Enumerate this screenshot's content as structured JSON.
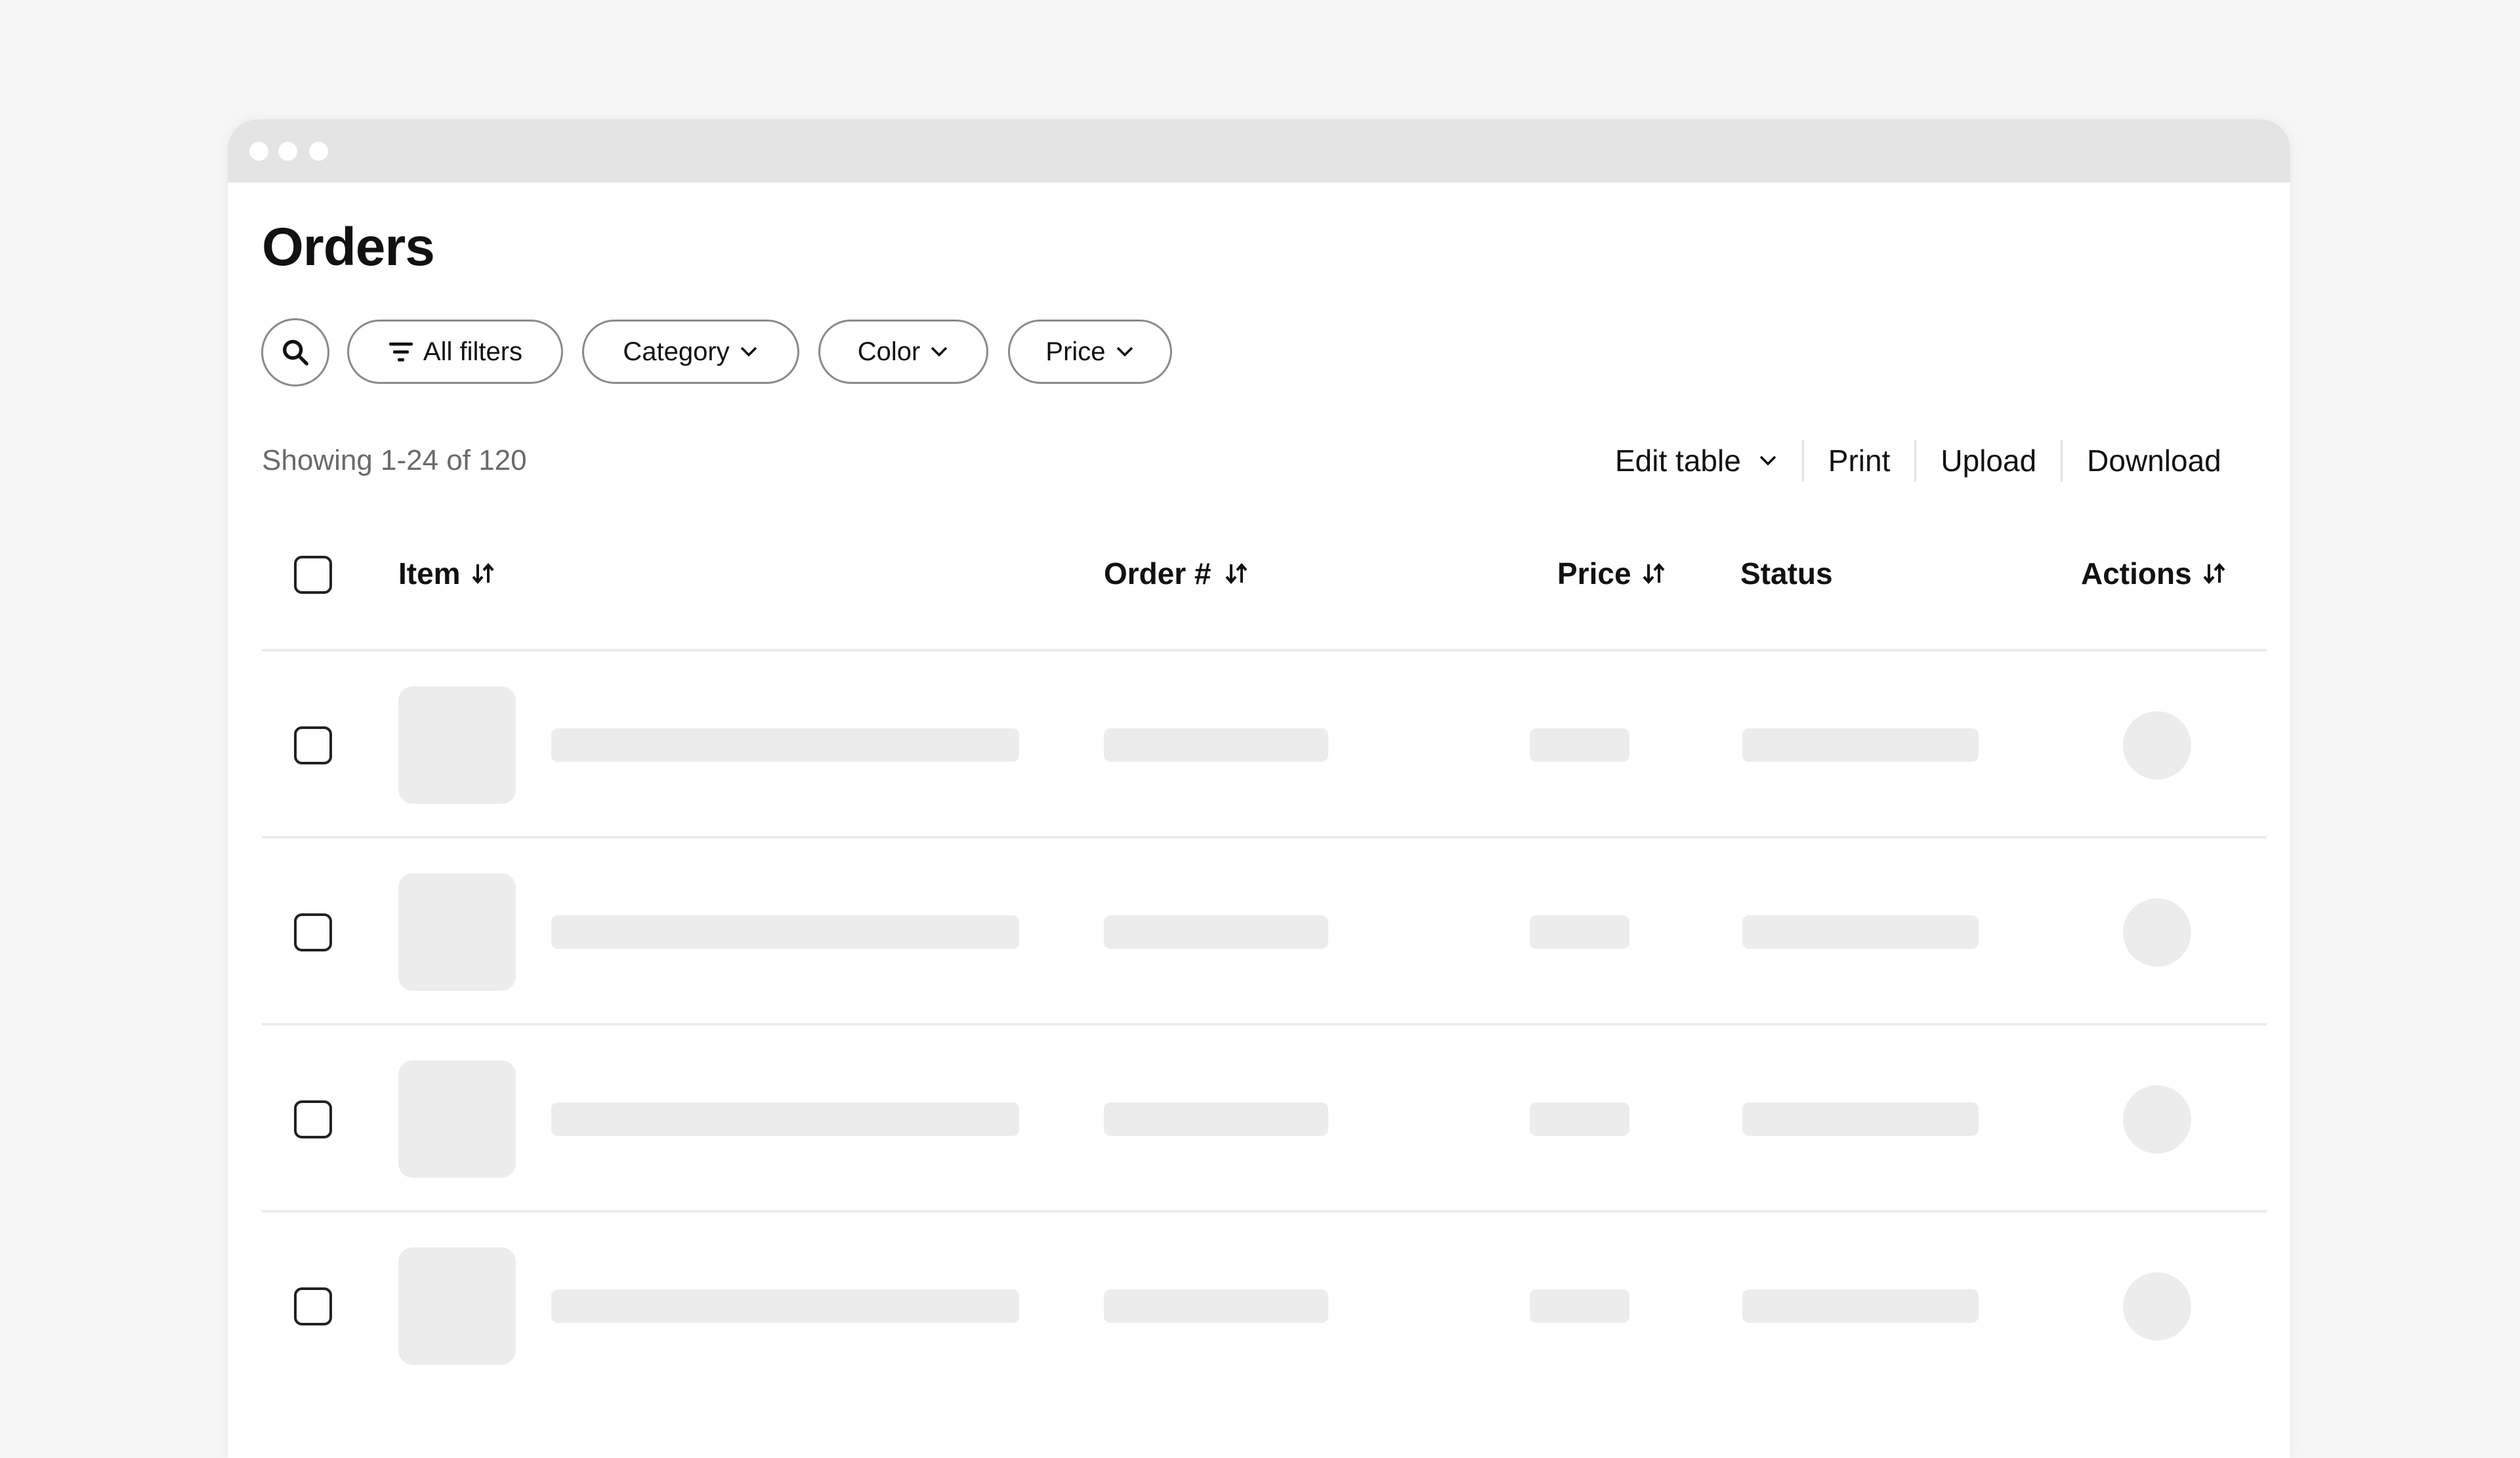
{
  "window": {
    "titlebar_dots": [
      "dot",
      "dot",
      "dot"
    ]
  },
  "page": {
    "title": "Orders"
  },
  "filters": {
    "search_icon": "search-icon",
    "all_filters": {
      "label": "All filters",
      "icon": "filter-lines-icon"
    },
    "dropdowns": [
      {
        "label": "Category",
        "icon": "chevron-down-icon"
      },
      {
        "label": "Color",
        "icon": "chevron-down-icon"
      },
      {
        "label": "Price",
        "icon": "chevron-down-icon"
      }
    ]
  },
  "summary": {
    "showing_text": "Showing 1-24 of 120"
  },
  "toolbar": {
    "edit_table": "Edit table",
    "print": "Print",
    "upload": "Upload",
    "download": "Download"
  },
  "table": {
    "columns": [
      {
        "label": "Item",
        "sortable": true
      },
      {
        "label": "Order #",
        "sortable": true
      },
      {
        "label": "Price",
        "sortable": true
      },
      {
        "label": "Status",
        "sortable": false
      },
      {
        "label": "Actions",
        "sortable": true
      }
    ],
    "sort_icon": "sort-arrows-icon",
    "rows_loading": 4,
    "row_state": "skeleton-loading"
  },
  "colors": {
    "background": "#f6f6f6",
    "titlebar": "#e4e4e4",
    "skeleton": "#ececec",
    "text": "#111111",
    "muted_text": "#6a6a6a",
    "border": "#8a8a8a"
  }
}
